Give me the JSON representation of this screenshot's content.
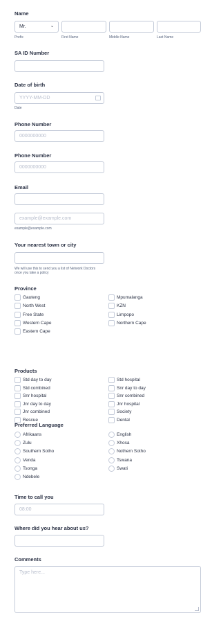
{
  "name": {
    "label": "Name",
    "prefix": {
      "value": "Mr.",
      "sub": "Prefix"
    },
    "first": {
      "sub": "First Name"
    },
    "middle": {
      "sub": "Middle Name"
    },
    "last": {
      "sub": "Last Name"
    }
  },
  "sa_id": {
    "label": "SA ID Number"
  },
  "dob": {
    "label": "Date of birth",
    "placeholder": "YYYY-MM-DD",
    "sub": "Date"
  },
  "phone1": {
    "label": "Phone Number",
    "placeholder": "0000000000"
  },
  "phone2": {
    "label": "Phone Number",
    "placeholder": "0000000000"
  },
  "email": {
    "label": "Email",
    "placeholder": "example@example.com",
    "sub": "example@example.com"
  },
  "town": {
    "label": "Your nearest town or city",
    "help_line1": "We will use this to send you a list of Network Doctors",
    "help_line2": "once you take a policy"
  },
  "province": {
    "label": "Province",
    "options": [
      "Gauteng",
      "Mpumalanga",
      "North West",
      "KZN",
      "Free State",
      "Limpopo",
      "Western Cape",
      "Northern Cape",
      "Eastern Cape"
    ]
  },
  "products": {
    "label": "Products",
    "options": [
      "Std day to day",
      "Std hospital",
      "Std combined",
      "Snr day to day",
      "Snr hospital",
      "Snr combined",
      "Jnr day to day",
      "Jnr hospital",
      "Jnr combined",
      "Society",
      "Rescue",
      "Dental"
    ]
  },
  "language": {
    "label": "Preferred Language",
    "options": [
      "Afrikaans",
      "English",
      "Zulu",
      "Xhosa",
      "Southern Sotho",
      "Nothern Sotho",
      "Venda",
      "Tswana",
      "Tsonga",
      "Swati",
      "Ndebele"
    ]
  },
  "time": {
    "label": "Time to call you",
    "placeholder": "08:00"
  },
  "hear": {
    "label": "Where did you hear about us?"
  },
  "comments": {
    "label": "Comments",
    "placeholder": "Type here..."
  }
}
